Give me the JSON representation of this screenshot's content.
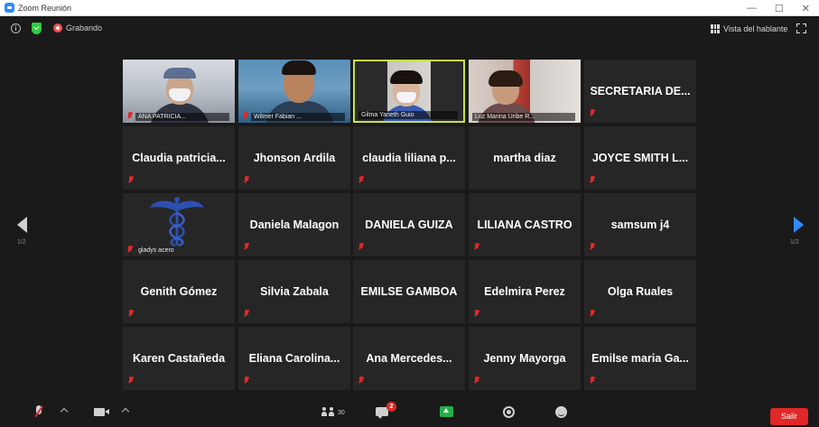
{
  "window": {
    "title": "Zoom Reunión",
    "controls": [
      "—",
      "☐",
      "✕"
    ]
  },
  "topbar": {
    "recording_label": "Grabando",
    "speaker_view_label": "Vista del hablante"
  },
  "pagination": {
    "left": "1/2",
    "right": "1/2"
  },
  "participants": [
    {
      "name": "ANA PATRICIA...",
      "video": true
    },
    {
      "name": "Wilmer Fabian ...",
      "video": true
    },
    {
      "name": "Gilma Yaneth Guio",
      "video": true,
      "active_speaker": true
    },
    {
      "name": "Luz Marina Uribe R...",
      "video": true
    },
    {
      "name": "SECRETARIA DE...",
      "video": false
    },
    {
      "name": "Claudia patricia...",
      "video": false
    },
    {
      "name": "Jhonson Ardila",
      "video": false
    },
    {
      "name": "claudia liliana p...",
      "video": false
    },
    {
      "name": "martha diaz",
      "video": false
    },
    {
      "name": "JOYCE SMITH L...",
      "video": false
    },
    {
      "name": "gladys acero",
      "video": true,
      "picture": "caduceus-logo"
    },
    {
      "name": "Daniela Malagon",
      "video": false
    },
    {
      "name": "DANIELA GUIZA",
      "video": false
    },
    {
      "name": "LILIANA CASTRO",
      "video": false
    },
    {
      "name": "samsum j4",
      "video": false
    },
    {
      "name": "Genith Gómez",
      "video": false
    },
    {
      "name": "Silvia Zabala",
      "video": false
    },
    {
      "name": "EMILSE GAMBOA",
      "video": false
    },
    {
      "name": "Edelmira Perez",
      "video": false
    },
    {
      "name": "Olga Ruales",
      "video": false
    },
    {
      "name": "Karen Castañeda",
      "video": false
    },
    {
      "name": "Eliana Carolina...",
      "video": false
    },
    {
      "name": "Ana Mercedes...",
      "video": false
    },
    {
      "name": "Jenny Mayorga",
      "video": false
    },
    {
      "name": "Emilse maria Ga...",
      "video": false
    }
  ],
  "toolbar": {
    "participants_count": "30",
    "chat_badge": "2",
    "leave_label": "Salir"
  },
  "colors": {
    "background": "#1a1a1a",
    "tile": "#262626",
    "active_border": "#c8e43a",
    "muted_icon": "#e02828",
    "share_button": "#22b14c",
    "leave_button": "#e02828",
    "accent": "#2d8cff"
  }
}
